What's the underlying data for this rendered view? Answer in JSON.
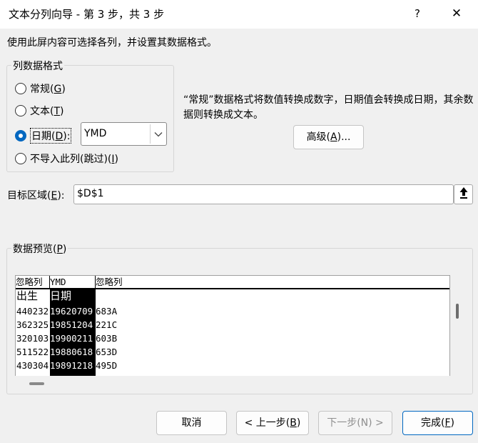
{
  "title": "文本分列向导 - 第 3 步，共 3 步",
  "help_glyph": "?",
  "close_glyph": "✕",
  "description": "使用此屏内容可选择各列，并设置其数据格式。",
  "format_group": {
    "legend": "列数据格式",
    "options": [
      {
        "label": "常规(",
        "key": "G",
        "tail": ")",
        "checked": false
      },
      {
        "label": "文本(",
        "key": "T",
        "tail": ")",
        "checked": false
      },
      {
        "label": "日期(",
        "key": "D",
        "tail": "):",
        "checked": true
      },
      {
        "label": "不导入此列(跳过)(",
        "key": "I",
        "tail": ")",
        "checked": false
      }
    ],
    "date_format": "YMD"
  },
  "info_text": "“常规”数据格式将数值转换成数字，日期值会转换成日期，其余数据则转换成文本。",
  "advanced_button": {
    "label": "高级(",
    "key": "A",
    "tail": ")..."
  },
  "destination": {
    "label": "目标区域(",
    "key": "E",
    "tail": "):",
    "value": "$D$1"
  },
  "preview": {
    "legend": "数据预览(",
    "legend_key": "P",
    "legend_tail": ")",
    "headers": [
      "忽略列",
      "YMD",
      "忽略列"
    ],
    "rows": [
      {
        "a": "出生",
        "b": "日期",
        "c": ""
      },
      {
        "a": "440232",
        "b": "19620709",
        "c": "683A"
      },
      {
        "a": "362325",
        "b": "19851204",
        "c": "221C"
      },
      {
        "a": "320103",
        "b": "19900211",
        "c": "603B"
      },
      {
        "a": "511522",
        "b": "19880618",
        "c": "653D"
      },
      {
        "a": "430304",
        "b": "19891218",
        "c": "495D"
      }
    ]
  },
  "footer": {
    "cancel": "取消",
    "back": {
      "label": "< 上一步(",
      "key": "B",
      "tail": ")"
    },
    "next": "下一步(N) >",
    "finish": {
      "label": "完成(",
      "key": "F",
      "tail": ")"
    }
  },
  "colors": {
    "accent": "#0067c0",
    "background": "#f0f0f0"
  }
}
